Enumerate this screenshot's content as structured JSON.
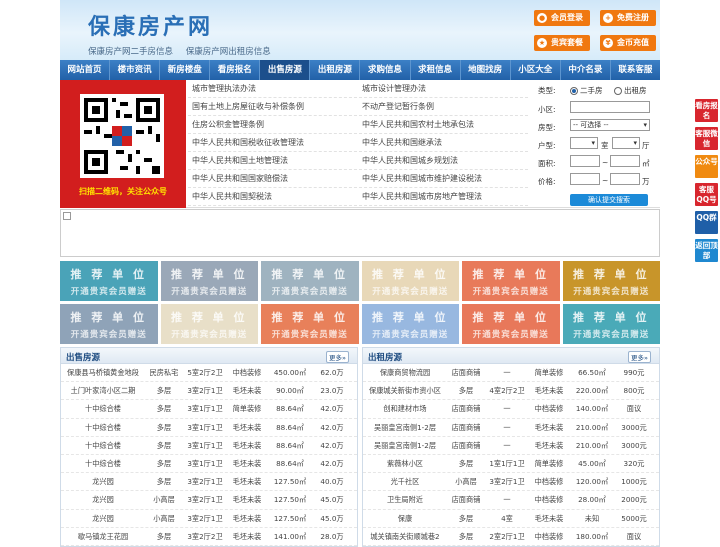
{
  "header": {
    "title": "保康房产网",
    "sub_links": [
      "保康房产网二手房信息",
      "保康房产网出租房信息"
    ],
    "buttons": [
      {
        "label": "会员登录",
        "icon": "user-icon"
      },
      {
        "label": "免费注册",
        "icon": "register-icon"
      },
      {
        "label": "贵宾套餐",
        "icon": "vip-icon"
      },
      {
        "label": "金币充值",
        "icon": "coin-icon"
      }
    ]
  },
  "nav": [
    "网站首页",
    "楼市资讯",
    "新房楼盘",
    "看房报名",
    "出售房源",
    "出租房源",
    "求购信息",
    "求租信息",
    "地图找房",
    "小区大全",
    "中介名录",
    "联系客服"
  ],
  "qr": {
    "caption": "扫描二维码，关注公众号"
  },
  "policy_links": [
    [
      "城市管理执法办法",
      "城市设计管理办法"
    ],
    [
      "国有土地上房屋征收与补偿条例",
      "不动产登记暂行条例"
    ],
    [
      "住房公积金管理条例",
      "中华人民共和国农村土地承包法"
    ],
    [
      "中华人民共和国税收征收管理法",
      "中华人民共和国继承法"
    ],
    [
      "中华人民共和国土地管理法",
      "中华人民共和国城乡规划法"
    ],
    [
      "中华人民共和国国家赔偿法",
      "中华人民共和国城市维护建设税法"
    ],
    [
      "中华人民共和国契税法",
      "中华人民共和国城市房地产管理法"
    ]
  ],
  "search": {
    "type_label": "类型:",
    "type_options": [
      "二手房",
      "出租房"
    ],
    "community_label": "小区:",
    "house_type_label": "房型:",
    "house_type_value": "-- 可选择 --",
    "layout_label": "户型:",
    "room_unit": "室",
    "hall_unit": "厅",
    "area_label": "面积:",
    "area_unit": "㎡",
    "price_label": "价格:",
    "price_unit": "万",
    "range_sep": "~",
    "submit": "确认提交搜索"
  },
  "ads": {
    "line1": "推 荐 单 位",
    "line2": "开通贵宾会员赠送",
    "colors": [
      "#4aa3b8",
      "#9aa8b8",
      "#9fb3c0",
      "#e8d8b8",
      "#e87a5a",
      "#c8952a",
      "#8fa3b8",
      "#e8dfc8",
      "#e8805a",
      "#98b8e0",
      "#e8785a",
      "#4aaab8"
    ]
  },
  "sale": {
    "title": "出售房源",
    "more": "更多»",
    "rows": [
      [
        "保康县马桥镇黄金地段",
        "民房私宅",
        "5室2厅2卫",
        "中档装修",
        "450.00㎡",
        "62.0万"
      ],
      [
        "土门叶家湾小区二期",
        "多层",
        "3室2厅1卫",
        "毛坯未装",
        "90.00㎡",
        "23.0万"
      ],
      [
        "十中综合楼",
        "多层",
        "3室1厅1卫",
        "简单装修",
        "88.64㎡",
        "42.0万"
      ],
      [
        "十中综合楼",
        "多层",
        "3室1厅1卫",
        "毛坯未装",
        "88.64㎡",
        "42.0万"
      ],
      [
        "十中综合楼",
        "多层",
        "3室1厅1卫",
        "毛坯未装",
        "88.64㎡",
        "42.0万"
      ],
      [
        "十中综合楼",
        "多层",
        "3室1厅1卫",
        "毛坯未装",
        "88.64㎡",
        "42.0万"
      ],
      [
        "龙兴园",
        "多层",
        "3室2厅1卫",
        "毛坯未装",
        "127.50㎡",
        "40.0万"
      ],
      [
        "龙兴园",
        "小高层",
        "3室2厅1卫",
        "毛坯未装",
        "127.50㎡",
        "45.0万"
      ],
      [
        "龙兴园",
        "小高层",
        "3室2厅1卫",
        "毛坯未装",
        "127.50㎡",
        "45.0万"
      ],
      [
        "歇马镇龙王花园",
        "多层",
        "3室2厅2卫",
        "毛坯未装",
        "141.00㎡",
        "28.0万"
      ]
    ]
  },
  "rent": {
    "title": "出租房源",
    "more": "更多»",
    "rows": [
      [
        "保康商贸物流园",
        "店面商铺",
        "一",
        "简单装修",
        "66.50㎡",
        "990元"
      ],
      [
        "保康城关新街市资小区",
        "多层",
        "4室2厅2卫",
        "毛坯未装",
        "220.00㎡",
        "800元"
      ],
      [
        "创和建材市场",
        "店面商铺",
        "一",
        "中档装修",
        "140.00㎡",
        "面议"
      ],
      [
        "吴丽皇宫南侧1-2层",
        "店面商铺",
        "一",
        "毛坯未装",
        "210.00㎡",
        "3000元"
      ],
      [
        "吴丽皇宫南侧1-2层",
        "店面商铺",
        "一",
        "毛坯未装",
        "210.00㎡",
        "3000元"
      ],
      [
        "紫薇林小区",
        "多层",
        "1室1厅1卫",
        "简单装修",
        "45.00㎡",
        "320元"
      ],
      [
        "光千社区",
        "小高层",
        "3室2厅1卫",
        "中档装修",
        "120.00㎡",
        "1000元"
      ],
      [
        "卫生局附近",
        "店面商铺",
        "一",
        "中档装修",
        "28.00㎡",
        "2000元"
      ],
      [
        "保康",
        "多层",
        "4室",
        "毛坯未装",
        "未知",
        "5000元"
      ],
      [
        "城关镇南关街顺城巷2",
        "多层",
        "2室2厅1卫",
        "中档装修",
        "180.00㎡",
        "面议"
      ]
    ]
  },
  "side": [
    {
      "label": "看房报名",
      "color": "#d8262e"
    },
    {
      "label": "客服微信",
      "color": "#d8262e"
    },
    {
      "label": "公众号",
      "color": "#f08a10"
    },
    {
      "label": "客服QQ号",
      "color": "#d8262e"
    },
    {
      "label": "QQ群",
      "color": "#1f5fa8"
    },
    {
      "label": "返回顶部",
      "color": "#1f88d0"
    }
  ]
}
